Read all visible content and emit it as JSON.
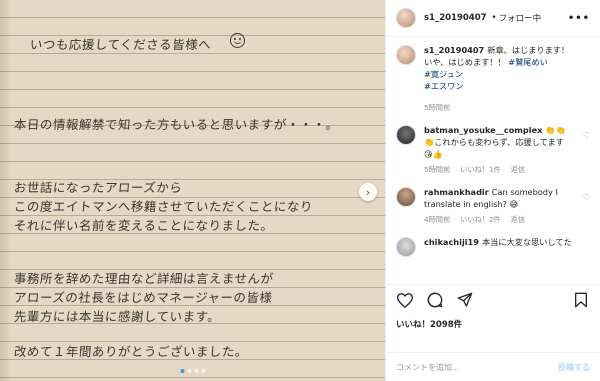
{
  "photo": {
    "letter_lines": [
      "いつも応援してくださる皆様へ",
      "本日の情報解禁で知った方もいると思いますが・・・。",
      "お世話になったアローズから",
      "この度エイトマンへ移籍させていただくことになり",
      "それに伴い名前を変えることになりました。",
      "事務所を辞めた理由など詳細は言えませんが",
      "アローズの社長をはじめマネージャーの皆様",
      "先輩方には本当に感謝しています。",
      "改めて１年間ありがとうございました。"
    ],
    "next_arrow": "›",
    "slide_count": 4,
    "active_slide": 1
  },
  "header": {
    "username": "s1_20190407",
    "separator": "•",
    "follow_status": "フォロー中",
    "more": "•••"
  },
  "caption": {
    "username": "s1_20190407",
    "text_1": "新章、はじまります！",
    "text_2": "いや、はじめます！！",
    "tag_1": "#鷲尾めい",
    "tag_2": "#寛ジュン",
    "tag_3": "#エスワン",
    "time": "5時間前"
  },
  "comments": [
    {
      "username": "batman_yosuke__complex",
      "text_1": "👏👏",
      "text_2": "👏これからも変わらず、応援してます",
      "text_3": "😘👍",
      "time": "5時間前",
      "likes": "いいね！1件",
      "reply": "返信"
    },
    {
      "username": "rahmankhadir",
      "text_1": "Can somebody I",
      "text_2": "translate in english? 😅",
      "time": "4時間前",
      "likes": "いいね！2件",
      "reply": "返信"
    },
    {
      "username": "chikachiji19",
      "text_1": "本当に大変な思いしてた"
    }
  ],
  "icons": {
    "heart": "heart-icon",
    "comment": "comment-icon",
    "share": "share-icon",
    "bookmark": "bookmark-icon"
  },
  "likes_label": "いいね！2098件",
  "add_comment": {
    "placeholder": "コメントを追加...",
    "post_label": "投稿する"
  },
  "colors": {
    "link_blue": "#003569",
    "post_button": "#b3dbff",
    "active_dot": "#3897f0"
  }
}
